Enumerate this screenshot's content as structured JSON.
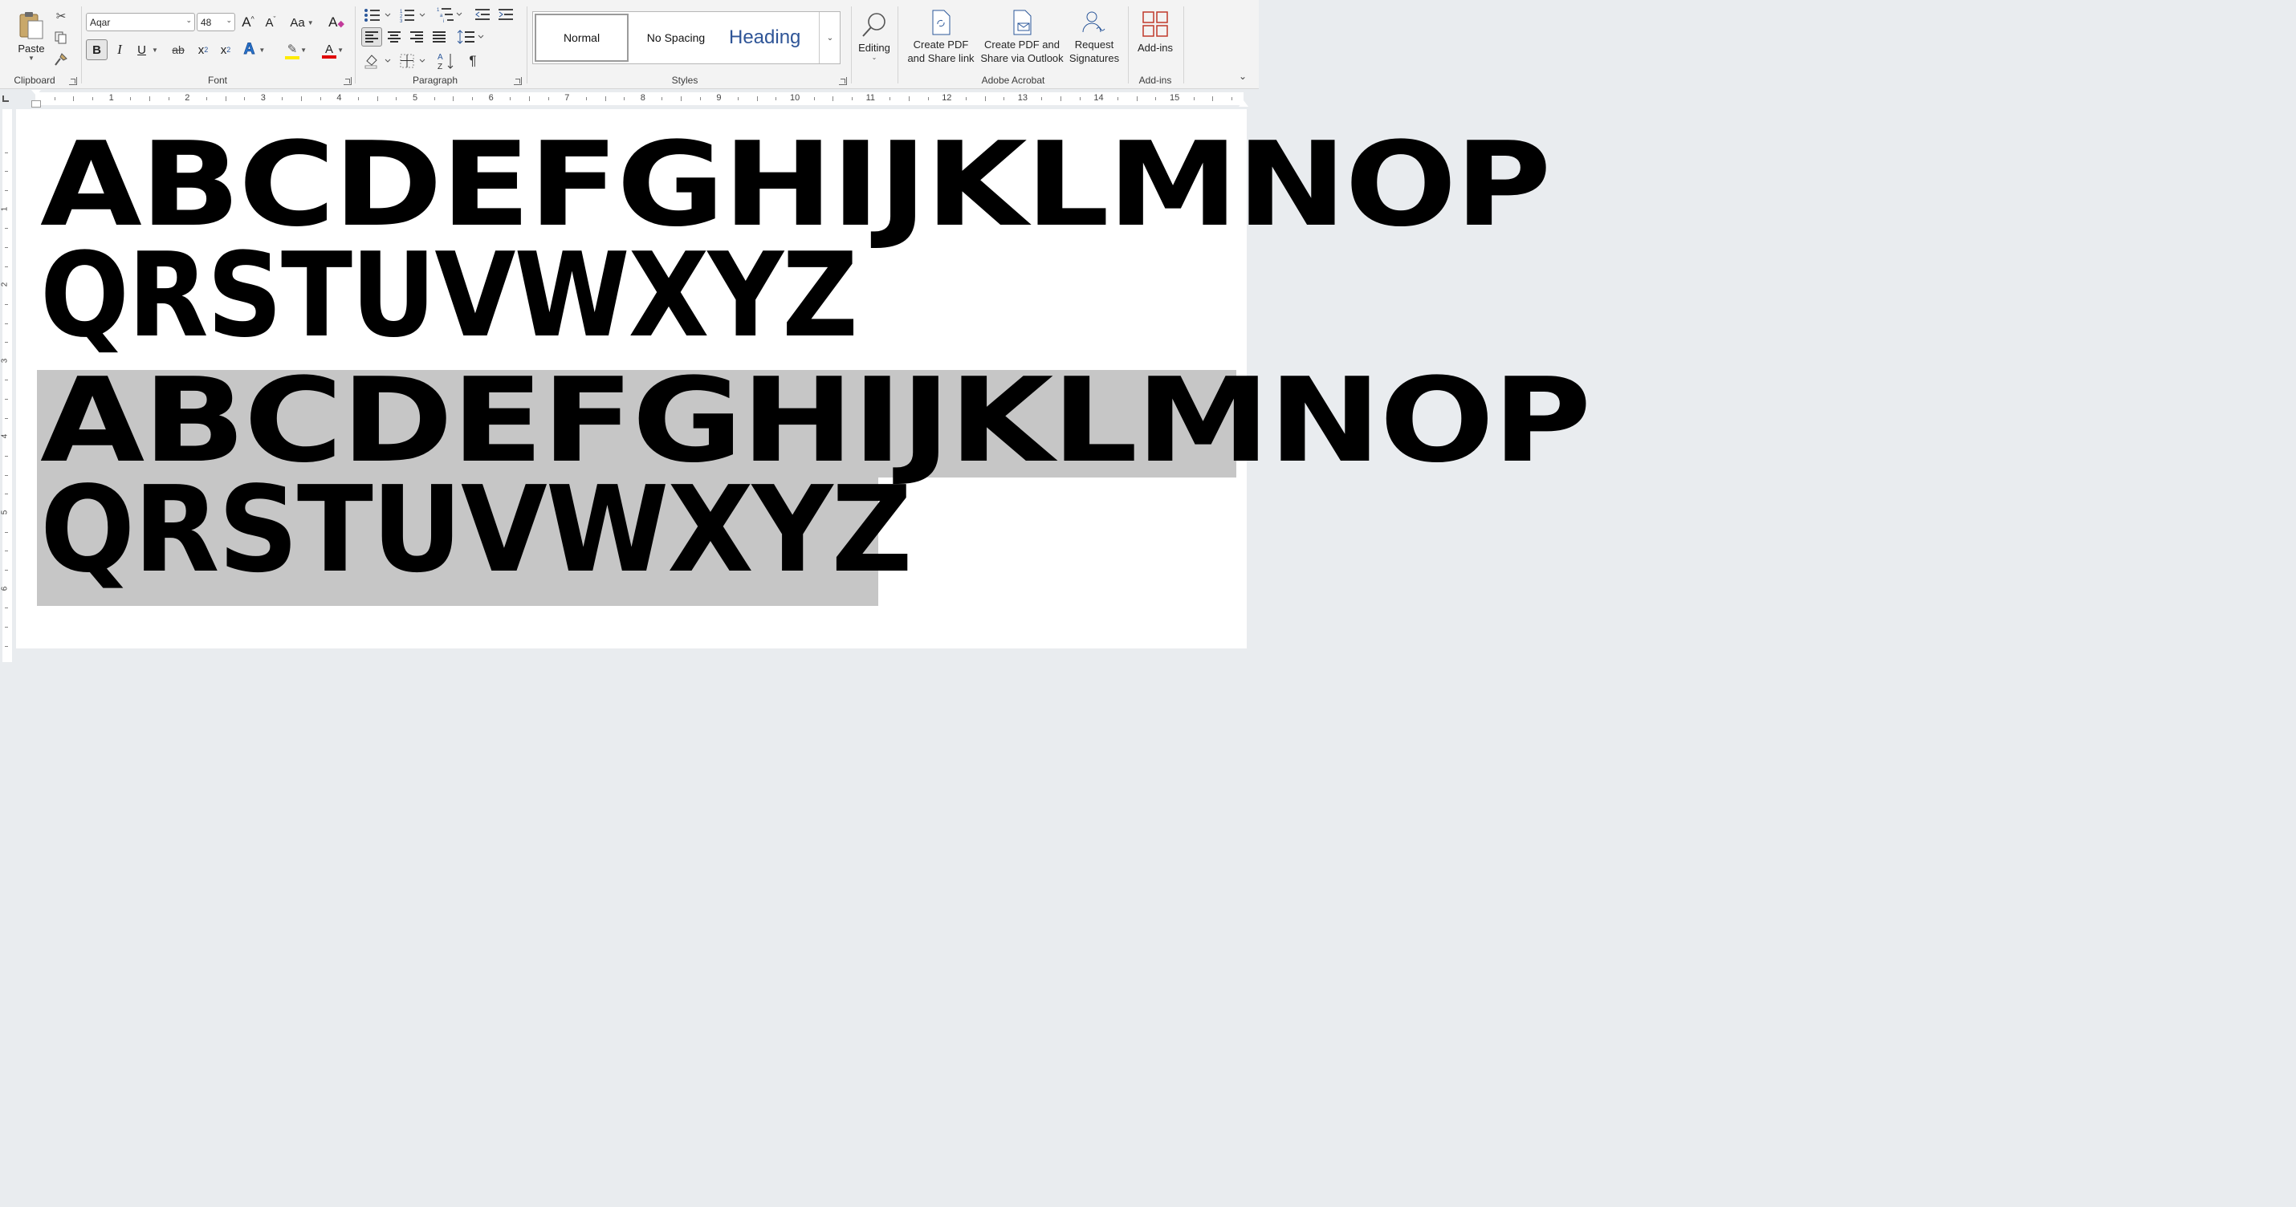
{
  "ribbon": {
    "clipboard": {
      "paste_label": "Paste",
      "group_label": "Clipboard"
    },
    "font": {
      "font_name": "Aqar",
      "font_size": "48",
      "group_label": "Font",
      "change_case_label": "Aa",
      "bold": "B",
      "italic": "I",
      "underline": "U",
      "strikethrough": "ab",
      "subscript": "x",
      "superscript": "x",
      "text_effects": "A",
      "font_color": "A"
    },
    "paragraph": {
      "group_label": "Paragraph",
      "pilcrow": "¶"
    },
    "styles": {
      "group_label": "Styles",
      "items": [
        "Normal",
        "No Spacing",
        "Heading"
      ]
    },
    "editing": {
      "label": "Editing"
    },
    "acrobat": {
      "group_label": "Adobe Acrobat",
      "create_share_link": [
        "Create PDF",
        "and Share link"
      ],
      "create_outlook": [
        "Create PDF and",
        "Share via Outlook"
      ],
      "request_signatures": [
        "Request",
        "Signatures"
      ]
    },
    "addins": {
      "label": "Add-ins",
      "group_label": "Add-ins"
    }
  },
  "ruler": {
    "numbers": [
      "1",
      "2",
      "3",
      "4",
      "5",
      "6",
      "7",
      "8",
      "9",
      "10",
      "11",
      "12",
      "13",
      "14",
      "15"
    ],
    "vertical_numbers": [
      "1",
      "2",
      "3",
      "4",
      "5",
      "6"
    ]
  },
  "document": {
    "line1": "ABCDEFGHIJKLMNOP",
    "line2": "QRSTUVWXYZ",
    "line3": "ABCDEFGHIJKLMNOP",
    "line4": "QRSTUVWXYZ"
  },
  "colors": {
    "highlight_yellow": "#ffeb00",
    "font_red": "#e00000",
    "accent_blue": "#2b579a",
    "selection_gray": "#c6c6c6"
  }
}
